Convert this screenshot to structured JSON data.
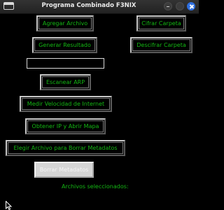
{
  "window": {
    "title": "Programa Combinado F3NIX"
  },
  "buttons": {
    "add_file": "Agregar Archivo",
    "encrypt_folder": "Cifrar Carpeta",
    "generate_result": "Generar Resultado",
    "decrypt_folder": "Descifrar Carpeta",
    "scan_arp": "Escanear ARP",
    "measure_speed": "Medir Velocidad de Internet",
    "get_ip_map": "Obtener IP y Abrir Mapa",
    "choose_metadata_file": "Elegir Archivo para Borrar Metadatos",
    "delete_metadata": "Borrar Metadatos"
  },
  "input": {
    "value": ""
  },
  "labels": {
    "selected_files": "Archivos seleccionados:"
  },
  "colors": {
    "background": "#000000",
    "text_green": "#14b814",
    "close_button": "#2f6fdf",
    "disabled_button": "#d6d6d6"
  }
}
